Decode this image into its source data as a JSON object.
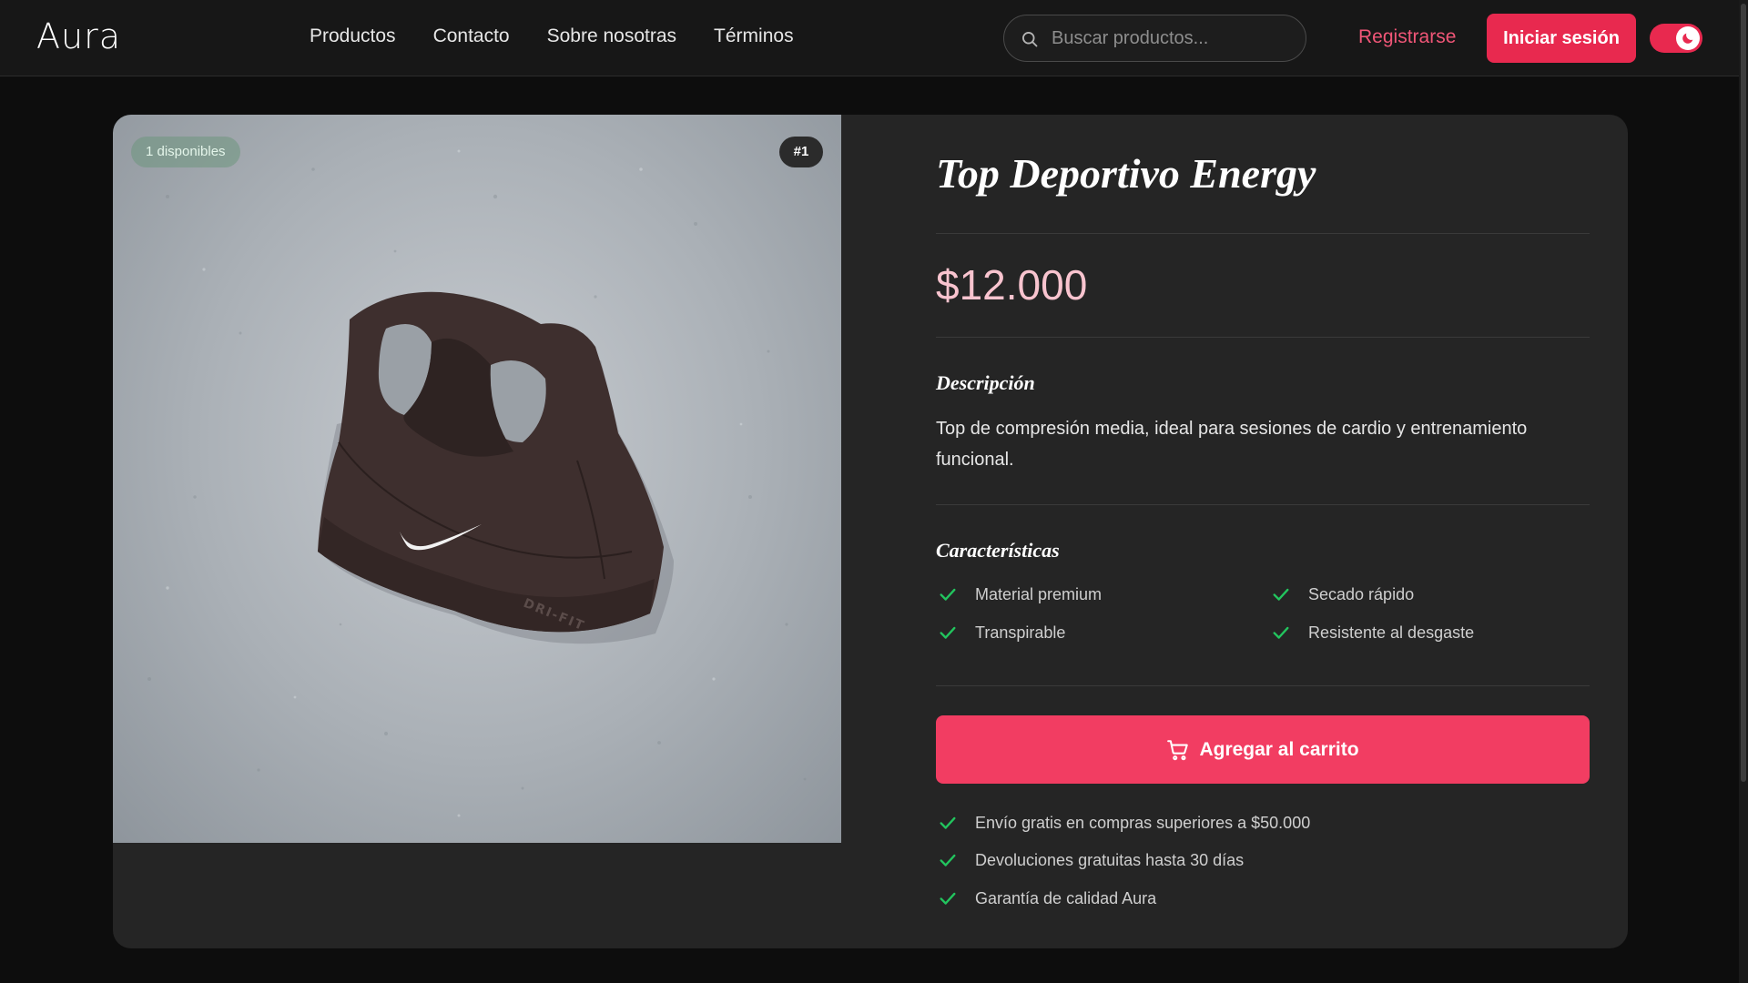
{
  "header": {
    "logo": "Aura",
    "nav": [
      "Productos",
      "Contacto",
      "Sobre nosotras",
      "Términos"
    ],
    "search_placeholder": "Buscar productos...",
    "register_label": "Registrarse",
    "login_label": "Iniciar sesión",
    "theme_toggle": "on",
    "icons": {
      "search": "search-icon",
      "theme": "moon-icon"
    }
  },
  "product": {
    "stock_badge": "1 disponibles",
    "rank_badge": "#1",
    "title": "Top Deportivo Energy",
    "price": "$12.000",
    "description_heading": "Descripción",
    "description": "Top de compresión media, ideal para sesiones de cardio y entrenamiento funcional.",
    "features_heading": "Características",
    "features": [
      "Material premium",
      "Secado rápido",
      "Transpirable",
      "Resistente al desgaste"
    ],
    "add_to_cart_label": "Agregar al carrito",
    "perks": [
      "Envío gratis en compras superiores a $50.000",
      "Devoluciones gratuitas hasta 30 días",
      "Garantía de calidad Aura"
    ],
    "image_printed_text": "DRI-FIT"
  },
  "colors": {
    "accent": "#e8294f",
    "button": "#f23d62",
    "price": "#f9c4cf",
    "check": "#22c55e",
    "page_background": "#0d0d0d",
    "card_background": "#252525",
    "header_background": "#171717"
  }
}
